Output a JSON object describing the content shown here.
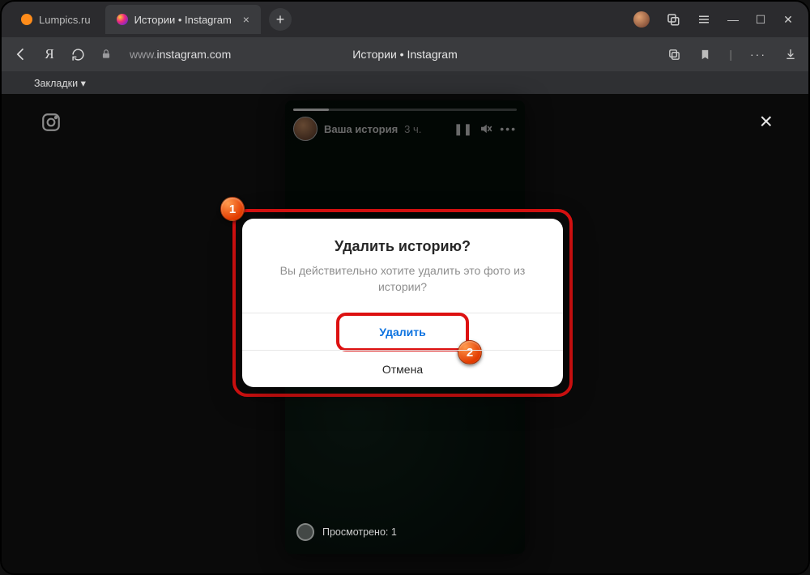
{
  "browser": {
    "tabs": [
      {
        "title": "Lumpics.ru",
        "active": false
      },
      {
        "title": "Истории • Instagram",
        "active": true
      }
    ],
    "url_prefix": "www.",
    "url_domain": "instagram.com",
    "page_title": "Истории • Instagram",
    "bookmarks_label": "Закладки ▾"
  },
  "story": {
    "author": "Ваша история",
    "time": "3 ч.",
    "views_label": "Просмотрено: 1"
  },
  "dialog": {
    "title": "Удалить историю?",
    "body": "Вы действительно хотите удалить это фото из истории?",
    "primary": "Удалить",
    "cancel": "Отмена"
  },
  "annotations": {
    "b1": "1",
    "b2": "2"
  }
}
